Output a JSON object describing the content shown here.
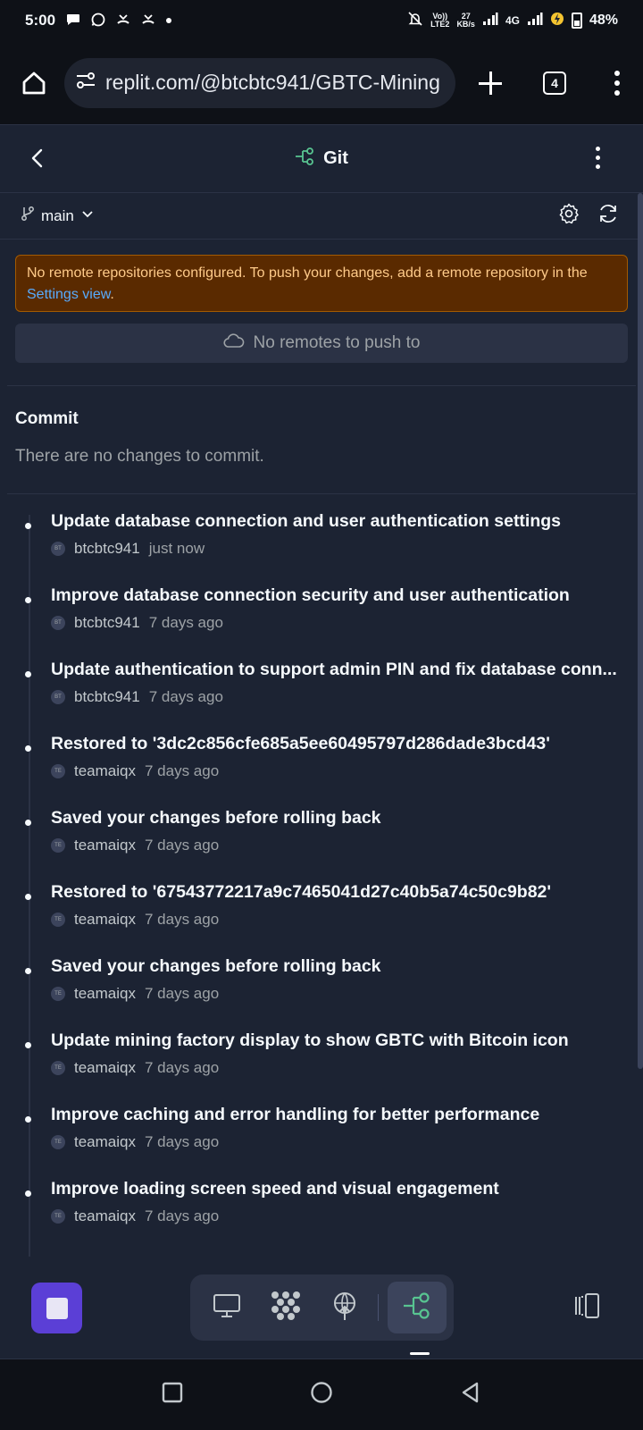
{
  "status_bar": {
    "time": "5:00",
    "speed_top": "27",
    "speed_unit": "KB/s",
    "volte_top": "Vo))",
    "volte_bottom": "LTE2",
    "network": "4G",
    "battery": "48%"
  },
  "browser": {
    "url": "replit.com/@btcbtc941/GBTC-Mining",
    "tab_count": "4"
  },
  "header": {
    "title": "Git"
  },
  "branch": {
    "name": "main"
  },
  "warning": {
    "text": "No remote repositories configured. To push your changes, add a remote repository in the ",
    "link": "Settings view",
    "suffix": "."
  },
  "remotes": {
    "empty_label": "No remotes to push to"
  },
  "commit": {
    "title": "Commit",
    "empty_message": "There are no changes to commit."
  },
  "commits": [
    {
      "message": "Update database connection and user authentication settings",
      "author": "btcbtc941",
      "initials": "BT",
      "time": "just now"
    },
    {
      "message": "Improve database connection security and user authentication",
      "author": "btcbtc941",
      "initials": "BT",
      "time": "7 days ago"
    },
    {
      "message": "Update authentication to support admin PIN and fix database conn...",
      "author": "btcbtc941",
      "initials": "BT",
      "time": "7 days ago"
    },
    {
      "message": "Restored to '3dc2c856cfe685a5ee60495797d286dade3bcd43'",
      "author": "teamaiqx",
      "initials": "TE",
      "time": "7 days ago"
    },
    {
      "message": "Saved your changes before rolling back",
      "author": "teamaiqx",
      "initials": "TE",
      "time": "7 days ago"
    },
    {
      "message": "Restored to '67543772217a9c7465041d27c40b5a74c50c9b82'",
      "author": "teamaiqx",
      "initials": "TE",
      "time": "7 days ago"
    },
    {
      "message": "Saved your changes before rolling back",
      "author": "teamaiqx",
      "initials": "TE",
      "time": "7 days ago"
    },
    {
      "message": "Update mining factory display to show GBTC with Bitcoin icon",
      "author": "teamaiqx",
      "initials": "TE",
      "time": "7 days ago"
    },
    {
      "message": "Improve caching and error handling for better performance",
      "author": "teamaiqx",
      "initials": "TE",
      "time": "7 days ago"
    },
    {
      "message": "Improve loading screen speed and visual engagement",
      "author": "teamaiqx",
      "initials": "TE",
      "time": "7 days ago"
    }
  ],
  "colors": {
    "background": "#1c2333",
    "accent_green": "#58c491",
    "warning_bg": "#5a2a00",
    "link_blue": "#57abff",
    "stop_purple": "#5b3fd6"
  }
}
